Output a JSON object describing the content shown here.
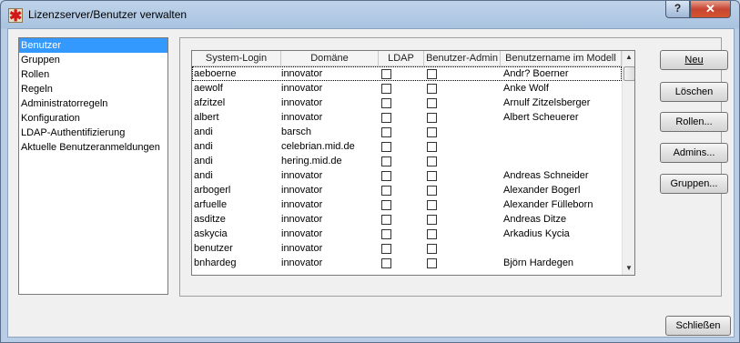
{
  "window": {
    "title": "Lizenzserver/Benutzer verwalten",
    "help_label": "?",
    "close_label": "✕",
    "app_icon_glyph": "✱"
  },
  "nav": {
    "items": [
      {
        "label": "Benutzer",
        "selected": true
      },
      {
        "label": "Gruppen"
      },
      {
        "label": "Rollen"
      },
      {
        "label": "Regeln"
      },
      {
        "label": "Administratorregeln"
      },
      {
        "label": "Konfiguration"
      },
      {
        "label": "LDAP-Authentifizierung"
      },
      {
        "label": "Aktuelle Benutzeranmeldungen"
      }
    ]
  },
  "table": {
    "columns": [
      "System-Login",
      "Domäne",
      "LDAP",
      "Benutzer-Admin",
      "Benutzername im Modell"
    ],
    "rows": [
      {
        "login": "aeboerne",
        "domain": "innovator",
        "ldap": false,
        "admin": false,
        "name": "Andr? Boerner"
      },
      {
        "login": "aewolf",
        "domain": "innovator",
        "ldap": false,
        "admin": false,
        "name": "Anke Wolf"
      },
      {
        "login": "afzitzel",
        "domain": "innovator",
        "ldap": false,
        "admin": false,
        "name": "Arnulf Zitzelsberger"
      },
      {
        "login": "albert",
        "domain": "innovator",
        "ldap": false,
        "admin": false,
        "name": "Albert Scheuerer"
      },
      {
        "login": "andi",
        "domain": "barsch",
        "ldap": false,
        "admin": false,
        "name": ""
      },
      {
        "login": "andi",
        "domain": "celebrian.mid.de",
        "ldap": false,
        "admin": false,
        "name": ""
      },
      {
        "login": "andi",
        "domain": "hering.mid.de",
        "ldap": false,
        "admin": false,
        "name": ""
      },
      {
        "login": "andi",
        "domain": "innovator",
        "ldap": false,
        "admin": false,
        "name": "Andreas Schneider"
      },
      {
        "login": "arbogerl",
        "domain": "innovator",
        "ldap": false,
        "admin": false,
        "name": "Alexander Bogerl"
      },
      {
        "login": "arfuelle",
        "domain": "innovator",
        "ldap": false,
        "admin": false,
        "name": "Alexander Fülleborn"
      },
      {
        "login": "asditze",
        "domain": "innovator",
        "ldap": false,
        "admin": false,
        "name": "Andreas Ditze"
      },
      {
        "login": "askycia",
        "domain": "innovator",
        "ldap": false,
        "admin": false,
        "name": "Arkadius Kycia"
      },
      {
        "login": "benutzer",
        "domain": "innovator",
        "ldap": false,
        "admin": false,
        "name": ""
      },
      {
        "login": "bnhardeg",
        "domain": "innovator",
        "ldap": false,
        "admin": false,
        "name": "Björn Hardegen"
      }
    ],
    "scroll_up_glyph": "▲",
    "scroll_down_glyph": "▼"
  },
  "actions": {
    "new_label": "Neu",
    "delete_label": "Löschen",
    "roles_label": "Rollen...",
    "admins_label": "Admins...",
    "groups_label": "Gruppen..."
  },
  "footer": {
    "close_label": "Schließen"
  },
  "icons": {
    "app": "asterisk-icon",
    "help": "help-icon",
    "close": "close-icon"
  }
}
